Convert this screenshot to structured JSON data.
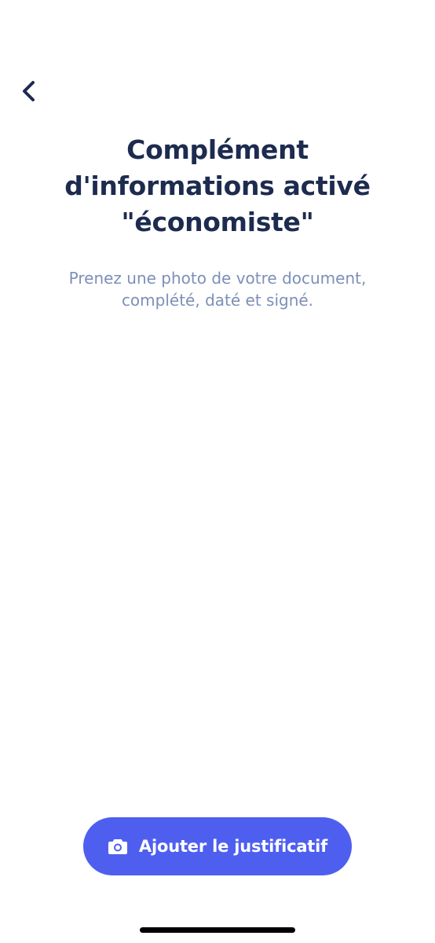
{
  "nav": {
    "back_icon": "chevron-left-icon"
  },
  "header": {
    "title": "Complément\nd'informations activé\n\"économiste\"",
    "subtitle": "Prenez une photo de votre document,\ncomplété, daté et signé."
  },
  "footer": {
    "add_button_label": "Ajouter le justificatif",
    "add_button_icon": "camera-icon"
  },
  "colors": {
    "title": "#1d2b4f",
    "subtitle": "#7d8fb8",
    "accent": "#4e5ff0",
    "background": "#ffffff"
  }
}
